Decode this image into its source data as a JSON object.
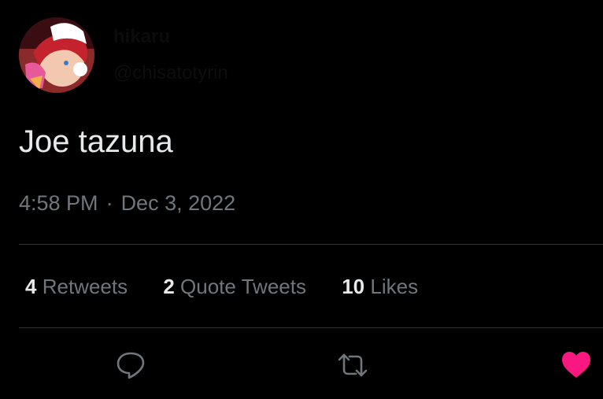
{
  "tweet": {
    "text": "Joe tazuna",
    "time": "4:58 PM",
    "separator": "·",
    "date": "Dec 3, 2022"
  },
  "author": {
    "display_name": "hikaru",
    "handle": "@chisatotyrin"
  },
  "stats": {
    "retweets": {
      "count": "4",
      "label": "Retweets"
    },
    "quote_tweets": {
      "count": "2",
      "label": "Quote Tweets"
    },
    "likes": {
      "count": "10",
      "label": "Likes"
    }
  },
  "actions": {
    "reply_icon": "reply-icon",
    "retweet_icon": "retweet-icon",
    "like_icon": "heart-icon",
    "liked": true
  },
  "colors": {
    "background": "#000000",
    "text": "#e7e9ea",
    "secondary": "#71767b",
    "divider": "#2f3336",
    "like": "#f91880"
  }
}
